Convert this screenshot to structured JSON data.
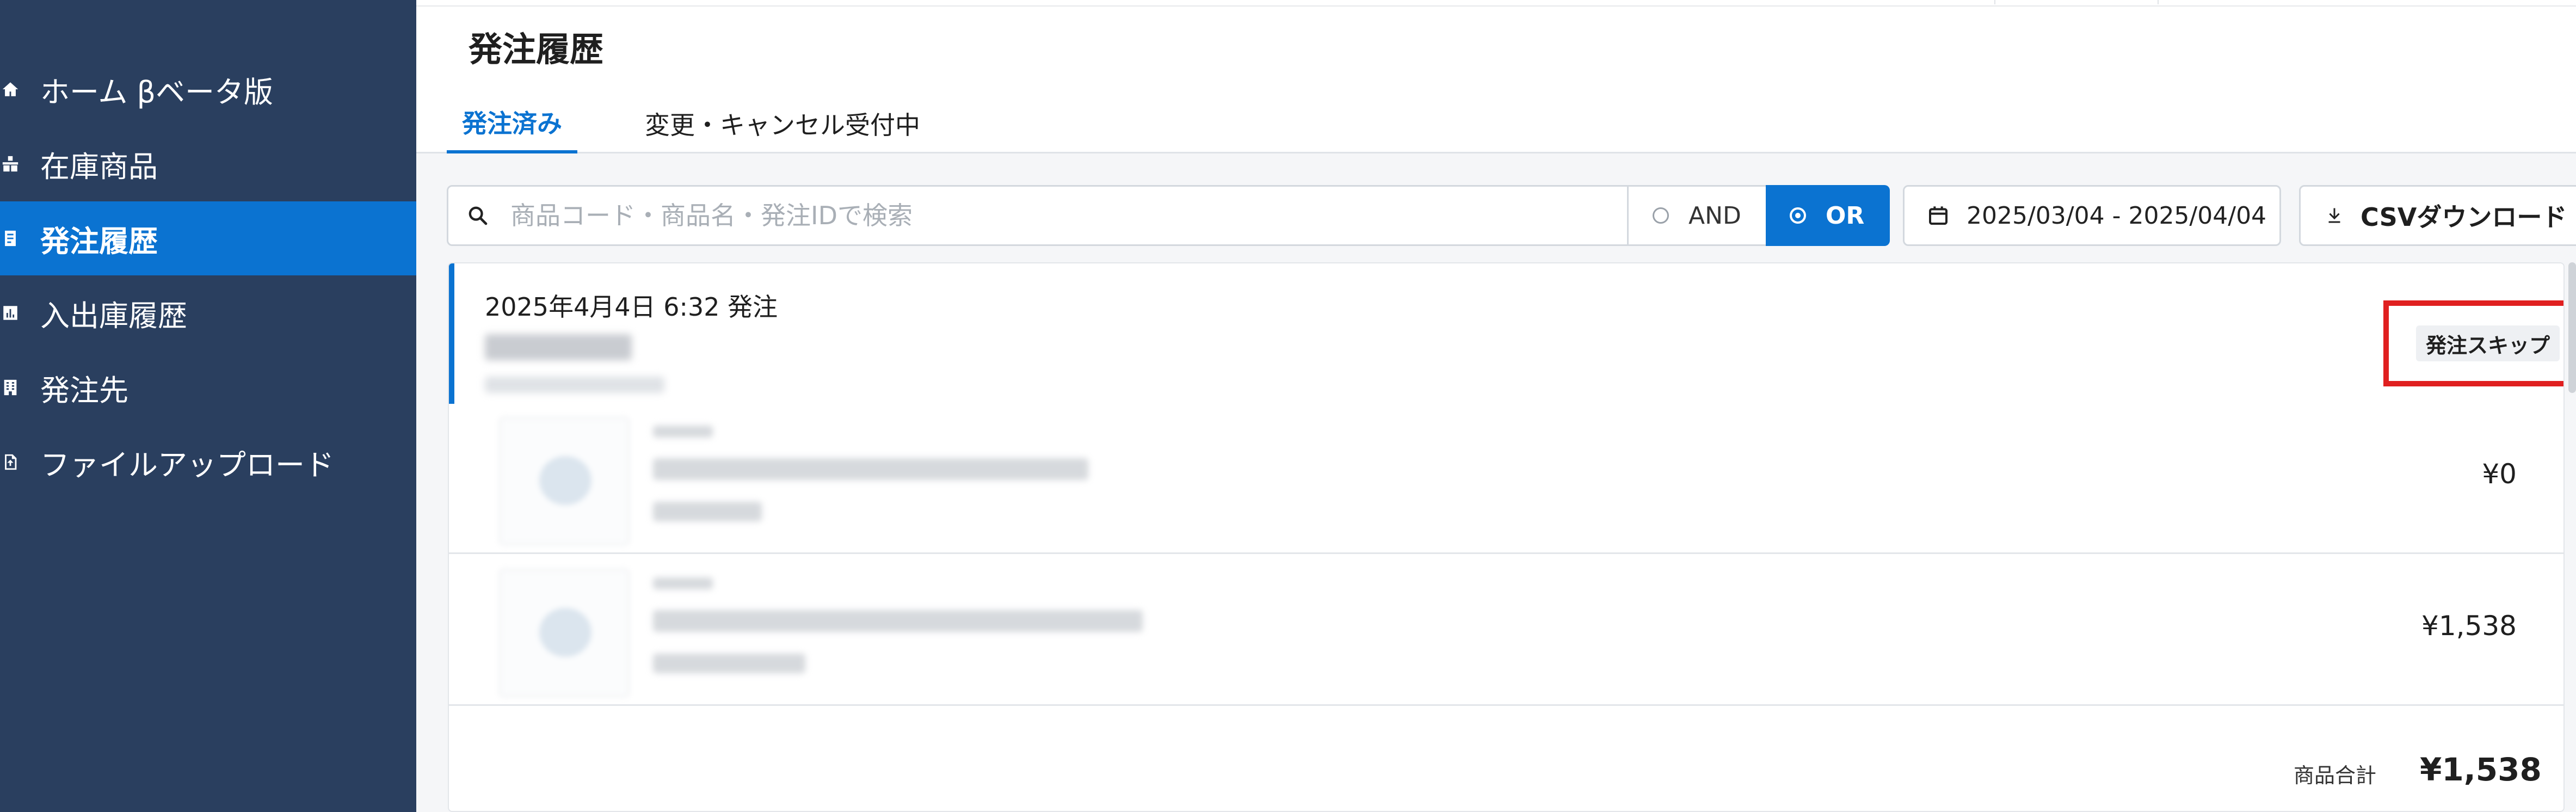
{
  "sidebar": {
    "items": [
      {
        "label": "ホーム βベータ版",
        "icon": "home-icon"
      },
      {
        "label": "在庫商品",
        "icon": "inventory-icon"
      },
      {
        "label": "発注履歴",
        "icon": "order-history-icon",
        "active": true
      },
      {
        "label": "入出庫履歴",
        "icon": "chart-icon"
      },
      {
        "label": "発注先",
        "icon": "building-icon"
      },
      {
        "label": "ファイルアップロード",
        "icon": "file-upload-icon"
      }
    ]
  },
  "header": {
    "title": "発注履歴",
    "tabs": [
      {
        "label": "発注済み",
        "active": true
      },
      {
        "label": "変更・キャンセル受付中",
        "active": false
      }
    ]
  },
  "toolbar": {
    "search_placeholder": "商品コード・商品名・発注IDで検索",
    "and_label": "AND",
    "or_label": "OR",
    "or_selected": true,
    "date_range": "2025/03/04 - 2025/04/04",
    "csv_label": "CSVダウンロード"
  },
  "order": {
    "date": "2025年4月4日 6:32 発注",
    "status_badge": "発注スキップ",
    "items": [
      {
        "price": "¥0"
      },
      {
        "price": "¥1,538"
      }
    ],
    "total_label": "商品合計",
    "total_value": "¥1,538"
  },
  "colors": {
    "sidebar_bg": "#2a3f5f",
    "accent": "#0b73d1",
    "highlight_box": "#e02020"
  }
}
